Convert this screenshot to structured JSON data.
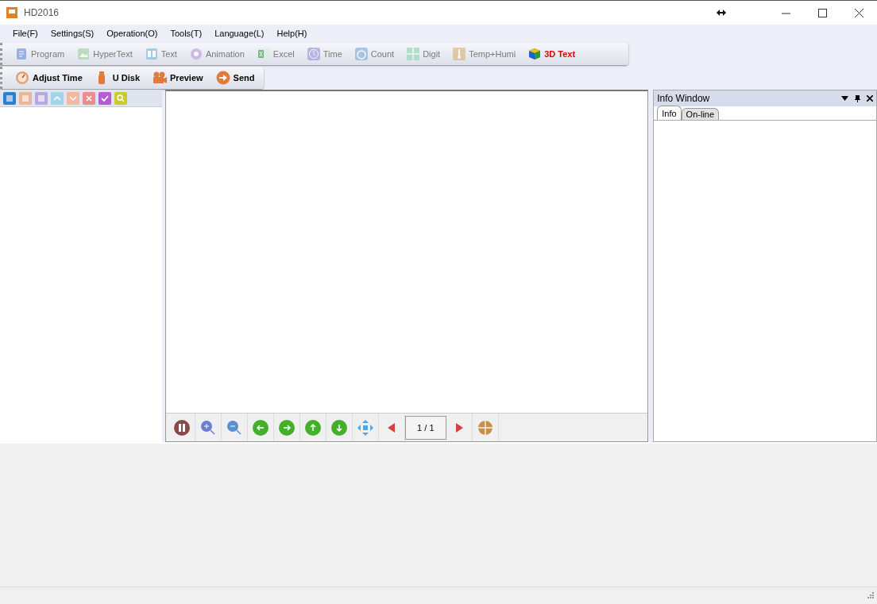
{
  "window": {
    "title": "HD2016"
  },
  "menu": [
    "File(F)",
    "Settings(S)",
    "Operation(O)",
    "Tools(T)",
    "Language(L)",
    "Help(H)"
  ],
  "toolbar": [
    {
      "label": "Program",
      "disabled": true
    },
    {
      "label": "HyperText",
      "disabled": true
    },
    {
      "label": "Text",
      "disabled": true
    },
    {
      "label": "Animation",
      "disabled": true
    },
    {
      "label": "Excel",
      "disabled": true
    },
    {
      "label": "Time",
      "disabled": true
    },
    {
      "label": "Count",
      "disabled": true
    },
    {
      "label": "Digit",
      "disabled": true
    },
    {
      "label": "Temp+Humi",
      "disabled": true
    },
    {
      "label": "3D Text",
      "disabled": false
    }
  ],
  "toolbar2": [
    {
      "label": "Adjust Time"
    },
    {
      "label": "U Disk"
    },
    {
      "label": "Preview"
    },
    {
      "label": "Send"
    }
  ],
  "preview_controls": {
    "page": "1 / 1"
  },
  "info_window": {
    "title": "Info Window",
    "tabs": [
      {
        "label": "Info",
        "selected": true
      },
      {
        "label": "On-line",
        "selected": false
      }
    ]
  }
}
